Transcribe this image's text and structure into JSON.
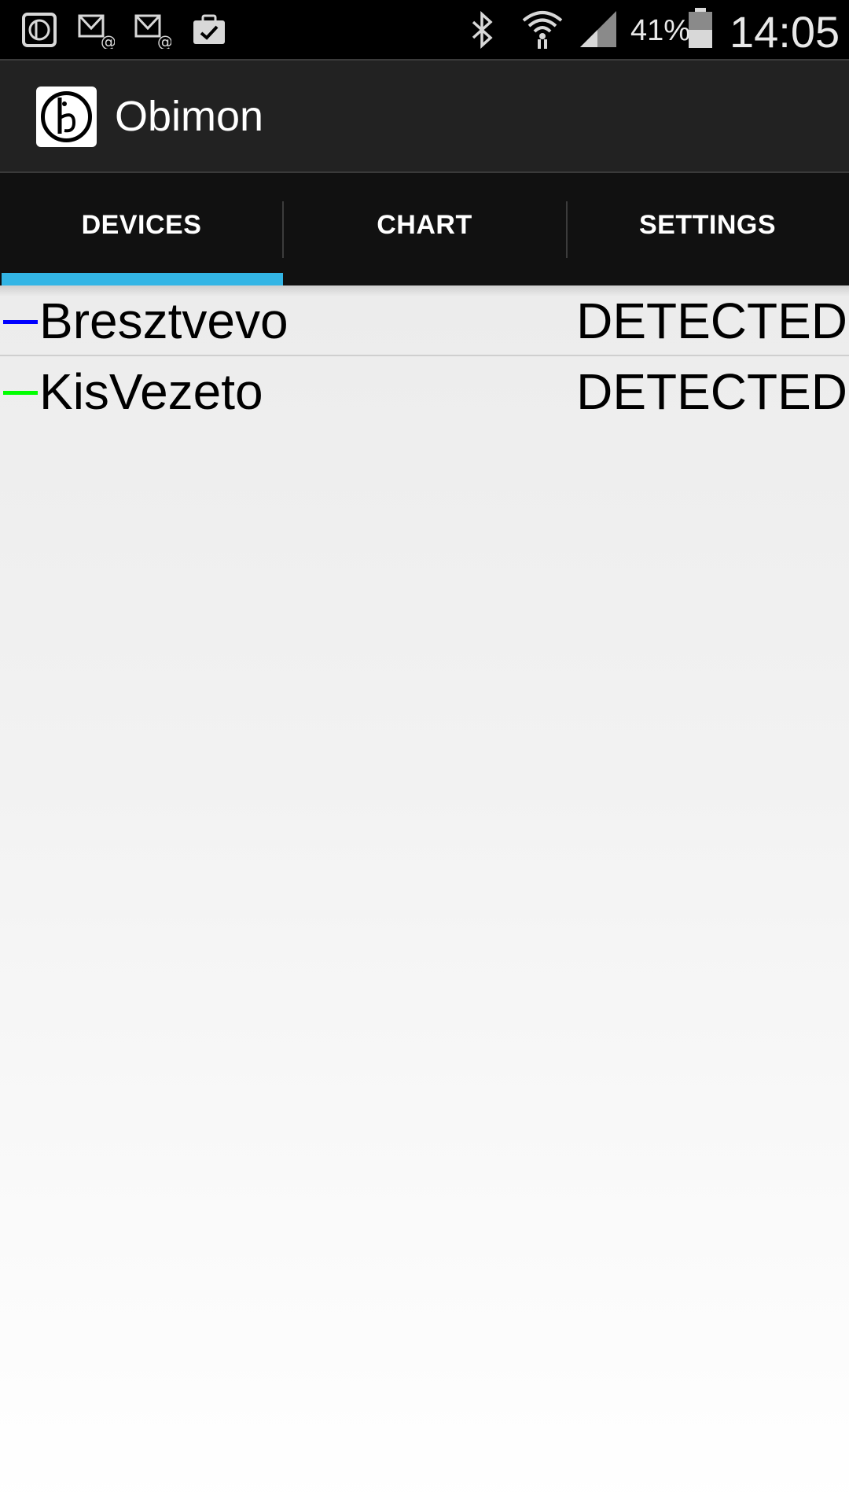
{
  "status_bar": {
    "battery_percent": "41%",
    "time": "14:05",
    "notification_icons": [
      "obimon-app-icon",
      "email-icon",
      "email-icon",
      "clipboard-check-icon"
    ],
    "system_icons": [
      "bluetooth-icon",
      "wifi-icon",
      "signal-icon",
      "battery-icon"
    ]
  },
  "action_bar": {
    "title": "Obimon",
    "logo_icon": "obimon-logo-icon"
  },
  "tabs": [
    {
      "label": "DEVICES",
      "selected": true
    },
    {
      "label": "CHART",
      "selected": false
    },
    {
      "label": "SETTINGS",
      "selected": false
    }
  ],
  "colors": {
    "tab_indicator": "#33b5e5",
    "device_1": "#0000ff",
    "device_2": "#00ff00"
  },
  "devices": [
    {
      "name": "Bresztvevo",
      "status": "DETECTED",
      "color": "#0000ff"
    },
    {
      "name": "KisVezeto",
      "status": "DETECTED",
      "color": "#00ff00"
    }
  ]
}
